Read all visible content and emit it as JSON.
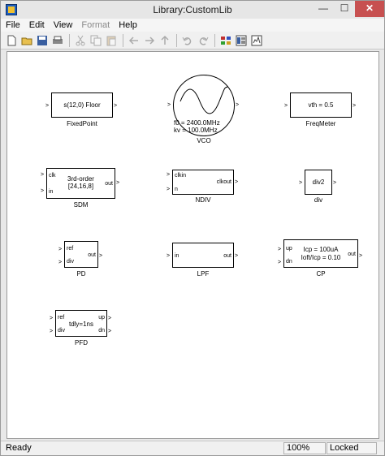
{
  "window": {
    "title": "Library:CustomLib"
  },
  "menu": {
    "file": "File",
    "edit": "Edit",
    "view": "View",
    "format": "Format",
    "help": "Help"
  },
  "toolbar": {
    "buttons": [
      "new-icon",
      "open-icon",
      "save-icon",
      "print-icon",
      "cut-icon",
      "copy-icon",
      "paste-icon",
      "back-icon",
      "forward-icon",
      "up-icon",
      "undo-icon",
      "redo-icon",
      "library-browser-icon",
      "model-explorer-icon",
      "debugger-icon"
    ]
  },
  "blocks": {
    "fixedpoint": {
      "text": "s(12,0)  Floor",
      "caption": "FixedPoint"
    },
    "vco": {
      "f0": "f0 = 2400.0MHz",
      "kv": "kv = 100.0MHz",
      "caption": "VCO"
    },
    "freqmeter": {
      "text": "vth = 0.5",
      "caption": "FreqMeter"
    },
    "sdm": {
      "in1": "clk",
      "in2": "in",
      "text1": "3rd-order",
      "text2": "[24,16,8]",
      "out": "out",
      "caption": "SDM"
    },
    "ndiv": {
      "in1": "clkin",
      "in2": "n",
      "out": "clkout",
      "caption": "NDIV"
    },
    "div": {
      "text": "div2",
      "caption": "div"
    },
    "pd": {
      "in1": "ref",
      "in2": "div",
      "out": "out",
      "caption": "PD"
    },
    "lpf": {
      "in": "in",
      "out": "out",
      "caption": "LPF"
    },
    "cp": {
      "in1": "up",
      "in2": "dn",
      "text1": "Icp = 100uA",
      "text2": "Ioft/Icp = 0.10",
      "out": "out",
      "caption": "CP"
    },
    "pfd": {
      "in1": "ref",
      "in2": "div",
      "text": "tdly=1ns",
      "out1": "up",
      "out2": "dn",
      "caption": "PFD"
    }
  },
  "status": {
    "text": "Ready",
    "zoom": "100%",
    "lock": "Locked"
  }
}
